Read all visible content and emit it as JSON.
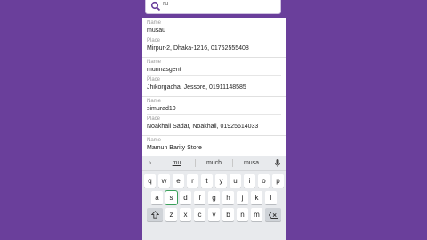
{
  "search": {
    "query": "ru"
  },
  "results": [
    {
      "name_label": "Name",
      "name": "musau",
      "place_label": "Place",
      "place": "Mirpur-2, Dhaka-1216, 01762555408"
    },
    {
      "name_label": "Name",
      "name": "munnasgent",
      "place_label": "Place",
      "place": "Jhikorgacha, Jessore, 01911148585"
    },
    {
      "name_label": "Name",
      "name": "simurad10",
      "place_label": "Place",
      "place": "Noakhali Sadar, Noakhali, 01925614033"
    },
    {
      "name_label": "Name",
      "name": "Mamun Barity Store"
    }
  ],
  "keyboard": {
    "suggestions": [
      "mu",
      "much",
      "musa"
    ],
    "row1": [
      "q",
      "w",
      "e",
      "r",
      "t",
      "y",
      "u",
      "i",
      "o",
      "p"
    ],
    "row2": [
      "a",
      "s",
      "d",
      "f",
      "g",
      "h",
      "j",
      "k",
      "l"
    ],
    "row3": [
      "z",
      "x",
      "c",
      "v",
      "b",
      "n",
      "m"
    ],
    "selected_key": "s"
  },
  "colors": {
    "background": "#6a3f9b",
    "accent": "#3aa05a"
  }
}
